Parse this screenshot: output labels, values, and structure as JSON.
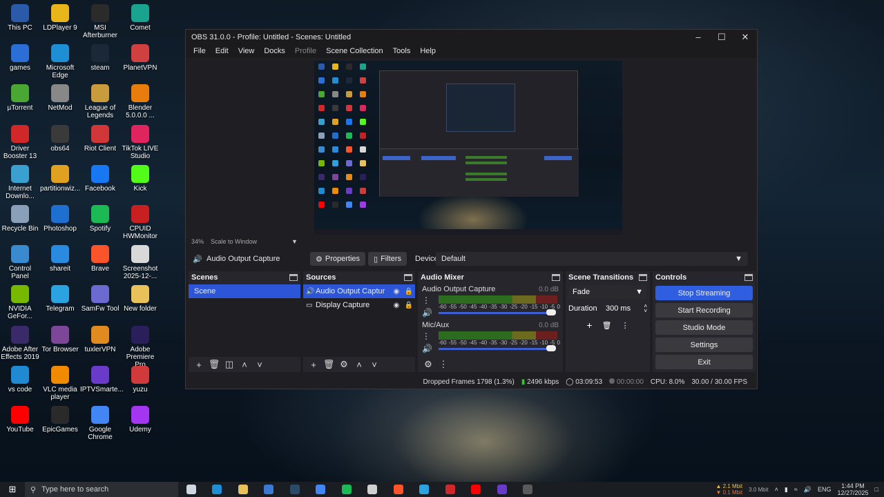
{
  "desktop": {
    "icons": [
      {
        "label": "This PC",
        "icon": "computer-icon",
        "color": "#2a5aa8"
      },
      {
        "label": "LDPlayer 9",
        "icon": "ldplayer-icon",
        "color": "#e8b51a"
      },
      {
        "label": "MSI Afterburner",
        "icon": "afterburner-icon",
        "color": "#2b2b2b"
      },
      {
        "label": "Comet",
        "icon": "comet-icon",
        "color": "#1aa38e"
      },
      {
        "label": "games",
        "icon": "gamepad-icon",
        "color": "#2b6fd6"
      },
      {
        "label": "Microsoft Edge",
        "icon": "edge-icon",
        "color": "#1e8fd4"
      },
      {
        "label": "steam",
        "icon": "steam-icon",
        "color": "#1b2838"
      },
      {
        "label": "PlanetVPN",
        "icon": "planetvpn-icon",
        "color": "#d04040"
      },
      {
        "label": "µTorrent",
        "icon": "utorrent-icon",
        "color": "#4aa832"
      },
      {
        "label": "NetMod",
        "icon": "netmod-icon",
        "color": "#888888"
      },
      {
        "label": "League of Legends",
        "icon": "lol-icon",
        "color": "#c89b3c"
      },
      {
        "label": "Blender 5.0.0.0 ...",
        "icon": "blender-icon",
        "color": "#e87d0d"
      },
      {
        "label": "Driver Booster 13",
        "icon": "driverbooster-icon",
        "color": "#d02828"
      },
      {
        "label": "obs64",
        "icon": "obs-icon",
        "color": "#3a3a3a"
      },
      {
        "label": "Riot Client",
        "icon": "riot-icon",
        "color": "#d13639"
      },
      {
        "label": "TikTok LIVE Studio",
        "icon": "tiktok-icon",
        "color": "#e0245e"
      },
      {
        "label": "Internet Downlo...",
        "icon": "idm-icon",
        "color": "#3aa0d0"
      },
      {
        "label": "partitionwiz...",
        "icon": "partition-icon",
        "color": "#e0a020"
      },
      {
        "label": "Facebook",
        "icon": "facebook-icon",
        "color": "#1877f2"
      },
      {
        "label": "Kick",
        "icon": "kick-icon",
        "color": "#53fc18"
      },
      {
        "label": "Recycle Bin",
        "icon": "recycle-bin-icon",
        "color": "#8aa0b8"
      },
      {
        "label": "Photoshop",
        "icon": "photoshop-icon",
        "color": "#1f6fd0"
      },
      {
        "label": "Spotify",
        "icon": "spotify-icon",
        "color": "#1db954"
      },
      {
        "label": "CPUID HWMonitor",
        "icon": "hwmonitor-icon",
        "color": "#c82020"
      },
      {
        "label": "Control Panel",
        "icon": "control-panel-icon",
        "color": "#3a8ad0"
      },
      {
        "label": "shareit",
        "icon": "shareit-icon",
        "color": "#2a8ae0"
      },
      {
        "label": "Brave",
        "icon": "brave-icon",
        "color": "#fb542b"
      },
      {
        "label": "Screenshot 2025-12-...",
        "icon": "screenshot-file-icon",
        "color": "#d8d8d8"
      },
      {
        "label": "NVIDIA GeFor...",
        "icon": "nvidia-icon",
        "color": "#76b900"
      },
      {
        "label": "Telegram",
        "icon": "telegram-icon",
        "color": "#2aa3e0"
      },
      {
        "label": "SamFw Tool",
        "icon": "samfw-icon",
        "color": "#6a6ad0"
      },
      {
        "label": "New folder",
        "icon": "folder-icon",
        "color": "#e8c15a"
      },
      {
        "label": "Adobe After Effects 2019",
        "icon": "aftereffects-icon",
        "color": "#3a2a6a"
      },
      {
        "label": "Tor Browser",
        "icon": "tor-icon",
        "color": "#7d4698"
      },
      {
        "label": "tuxlerVPN",
        "icon": "tuxler-icon",
        "color": "#e08a20"
      },
      {
        "label": "Adobe Premiere Pro",
        "icon": "premiere-icon",
        "color": "#2a1f5a"
      },
      {
        "label": "vs code",
        "icon": "vscode-icon",
        "color": "#1f8ad2"
      },
      {
        "label": "VLC media player",
        "icon": "vlc-icon",
        "color": "#f08a00"
      },
      {
        "label": "IPTVSmarte...",
        "icon": "iptv-icon",
        "color": "#6a3ac8"
      },
      {
        "label": "yuzu",
        "icon": "yuzu-icon",
        "color": "#d03a3a"
      },
      {
        "label": "YouTube",
        "icon": "youtube-icon",
        "color": "#ff0000"
      },
      {
        "label": "EpicGames",
        "icon": "epic-icon",
        "color": "#2a2a2a"
      },
      {
        "label": "Google Chrome",
        "icon": "chrome-icon",
        "color": "#4285f4"
      },
      {
        "label": "Udemy",
        "icon": "udemy-icon",
        "color": "#a435f0"
      }
    ]
  },
  "obs": {
    "title": "OBS 31.0.0 - Profile: Untitled - Scenes: Untitled",
    "menu": [
      "File",
      "Edit",
      "View",
      "Docks",
      "Profile",
      "Scene Collection",
      "Tools",
      "Help"
    ],
    "zoom": "34%",
    "scale_mode": "Scale to Window",
    "source_bar": {
      "source_name": "Audio Output Capture",
      "properties": "Properties",
      "filters": "Filters",
      "device_label": "Device",
      "device_value": "Default"
    },
    "scenes": {
      "title": "Scenes",
      "items": [
        "Scene"
      ]
    },
    "sources": {
      "title": "Sources",
      "items": [
        "Audio Output Captur",
        "Display Capture"
      ]
    },
    "mixer": {
      "title": "Audio Mixer",
      "channels": [
        {
          "name": "Audio Output Capture",
          "db": "0.0 dB"
        },
        {
          "name": "Mic/Aux",
          "db": "0.0 dB"
        }
      ],
      "ticks": [
        "-60",
        "-55",
        "-50",
        "-45",
        "-40",
        "-35",
        "-30",
        "-25",
        "-20",
        "-15",
        "-10",
        "-5",
        "0"
      ]
    },
    "transitions": {
      "title": "Scene Transitions",
      "type": "Fade",
      "duration_label": "Duration",
      "duration": "300 ms"
    },
    "controls": {
      "title": "Controls",
      "buttons": [
        "Stop Streaming",
        "Start Recording",
        "Studio Mode",
        "Settings",
        "Exit"
      ]
    },
    "status": {
      "dropped": "Dropped Frames 1798 (1.3%)",
      "bitrate": "2496 kbps",
      "stream_time": "03:09:53",
      "rec_time": "00:00:00",
      "cpu": "CPU: 8.0%",
      "fps": "30.00 / 30.00 FPS"
    }
  },
  "taskbar": {
    "search_placeholder": "Type here to search",
    "apps": [
      {
        "icon": "task-view-icon",
        "color": "#cfd8e0"
      },
      {
        "icon": "edge-icon",
        "color": "#1e8fd4"
      },
      {
        "icon": "file-explorer-icon",
        "color": "#e8c15a"
      },
      {
        "icon": "store-icon",
        "color": "#3a7ad0"
      },
      {
        "icon": "steam-icon",
        "color": "#2a4a6a"
      },
      {
        "icon": "chrome-icon",
        "color": "#4285f4"
      },
      {
        "icon": "spotify-icon",
        "color": "#1db954"
      },
      {
        "icon": "chatgpt-icon",
        "color": "#cfcfcf"
      },
      {
        "icon": "brave-icon",
        "color": "#fb542b"
      },
      {
        "icon": "telegram-icon",
        "color": "#2aa3e0"
      },
      {
        "icon": "driverbooster-icon",
        "color": "#d02828"
      },
      {
        "icon": "youtube-icon",
        "color": "#ff0000"
      },
      {
        "icon": "iptv-icon",
        "color": "#6a3ac8"
      },
      {
        "icon": "obs-icon",
        "color": "#5a5a5a"
      }
    ],
    "net_up": "2.1 Mbit",
    "net_down": "0.1 Mbit",
    "net_graph_label": "3.0 Mbit",
    "language": "ENG",
    "time": "1:44 PM",
    "date": "12/27/2025"
  }
}
